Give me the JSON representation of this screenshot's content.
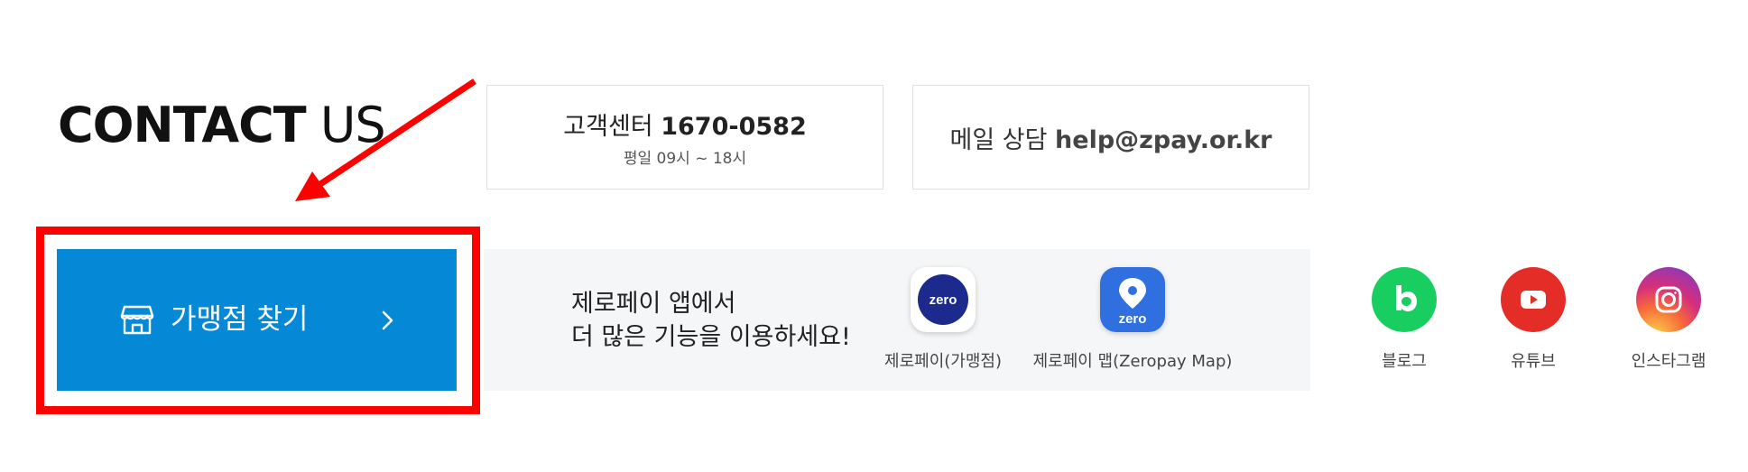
{
  "title": {
    "bold": "CONTACT",
    "light": "US"
  },
  "customer_center": {
    "prefix": "고객센터",
    "phone": "1670-0582",
    "hours": "평일 09시 ~ 18시"
  },
  "email": {
    "prefix": "메일 상담",
    "address": "help@zpay.or.kr"
  },
  "store_search": {
    "label": "가맹점 찾기",
    "icon": "store-icon",
    "chevron": "chevron-right-icon"
  },
  "promo": {
    "line1": "제로페이 앱에서",
    "line2": "더 많은 기능을 이용하세요!"
  },
  "apps": [
    {
      "label": "제로페이(가맹점)",
      "icon_text": "zero"
    },
    {
      "label": "제로페이 맵(Zeropay Map)",
      "icon_text": "zero"
    }
  ],
  "social": [
    {
      "label": "블로그",
      "icon": "naver-blog-icon",
      "color": "#19ce60"
    },
    {
      "label": "유튜브",
      "icon": "youtube-icon",
      "color": "#e52d27"
    },
    {
      "label": "인스타그램",
      "icon": "instagram-icon",
      "color": "#c13584"
    }
  ],
  "colors": {
    "store_button": "#0589d6",
    "annotation": "#ff0000",
    "band": "#f5f6f7"
  }
}
